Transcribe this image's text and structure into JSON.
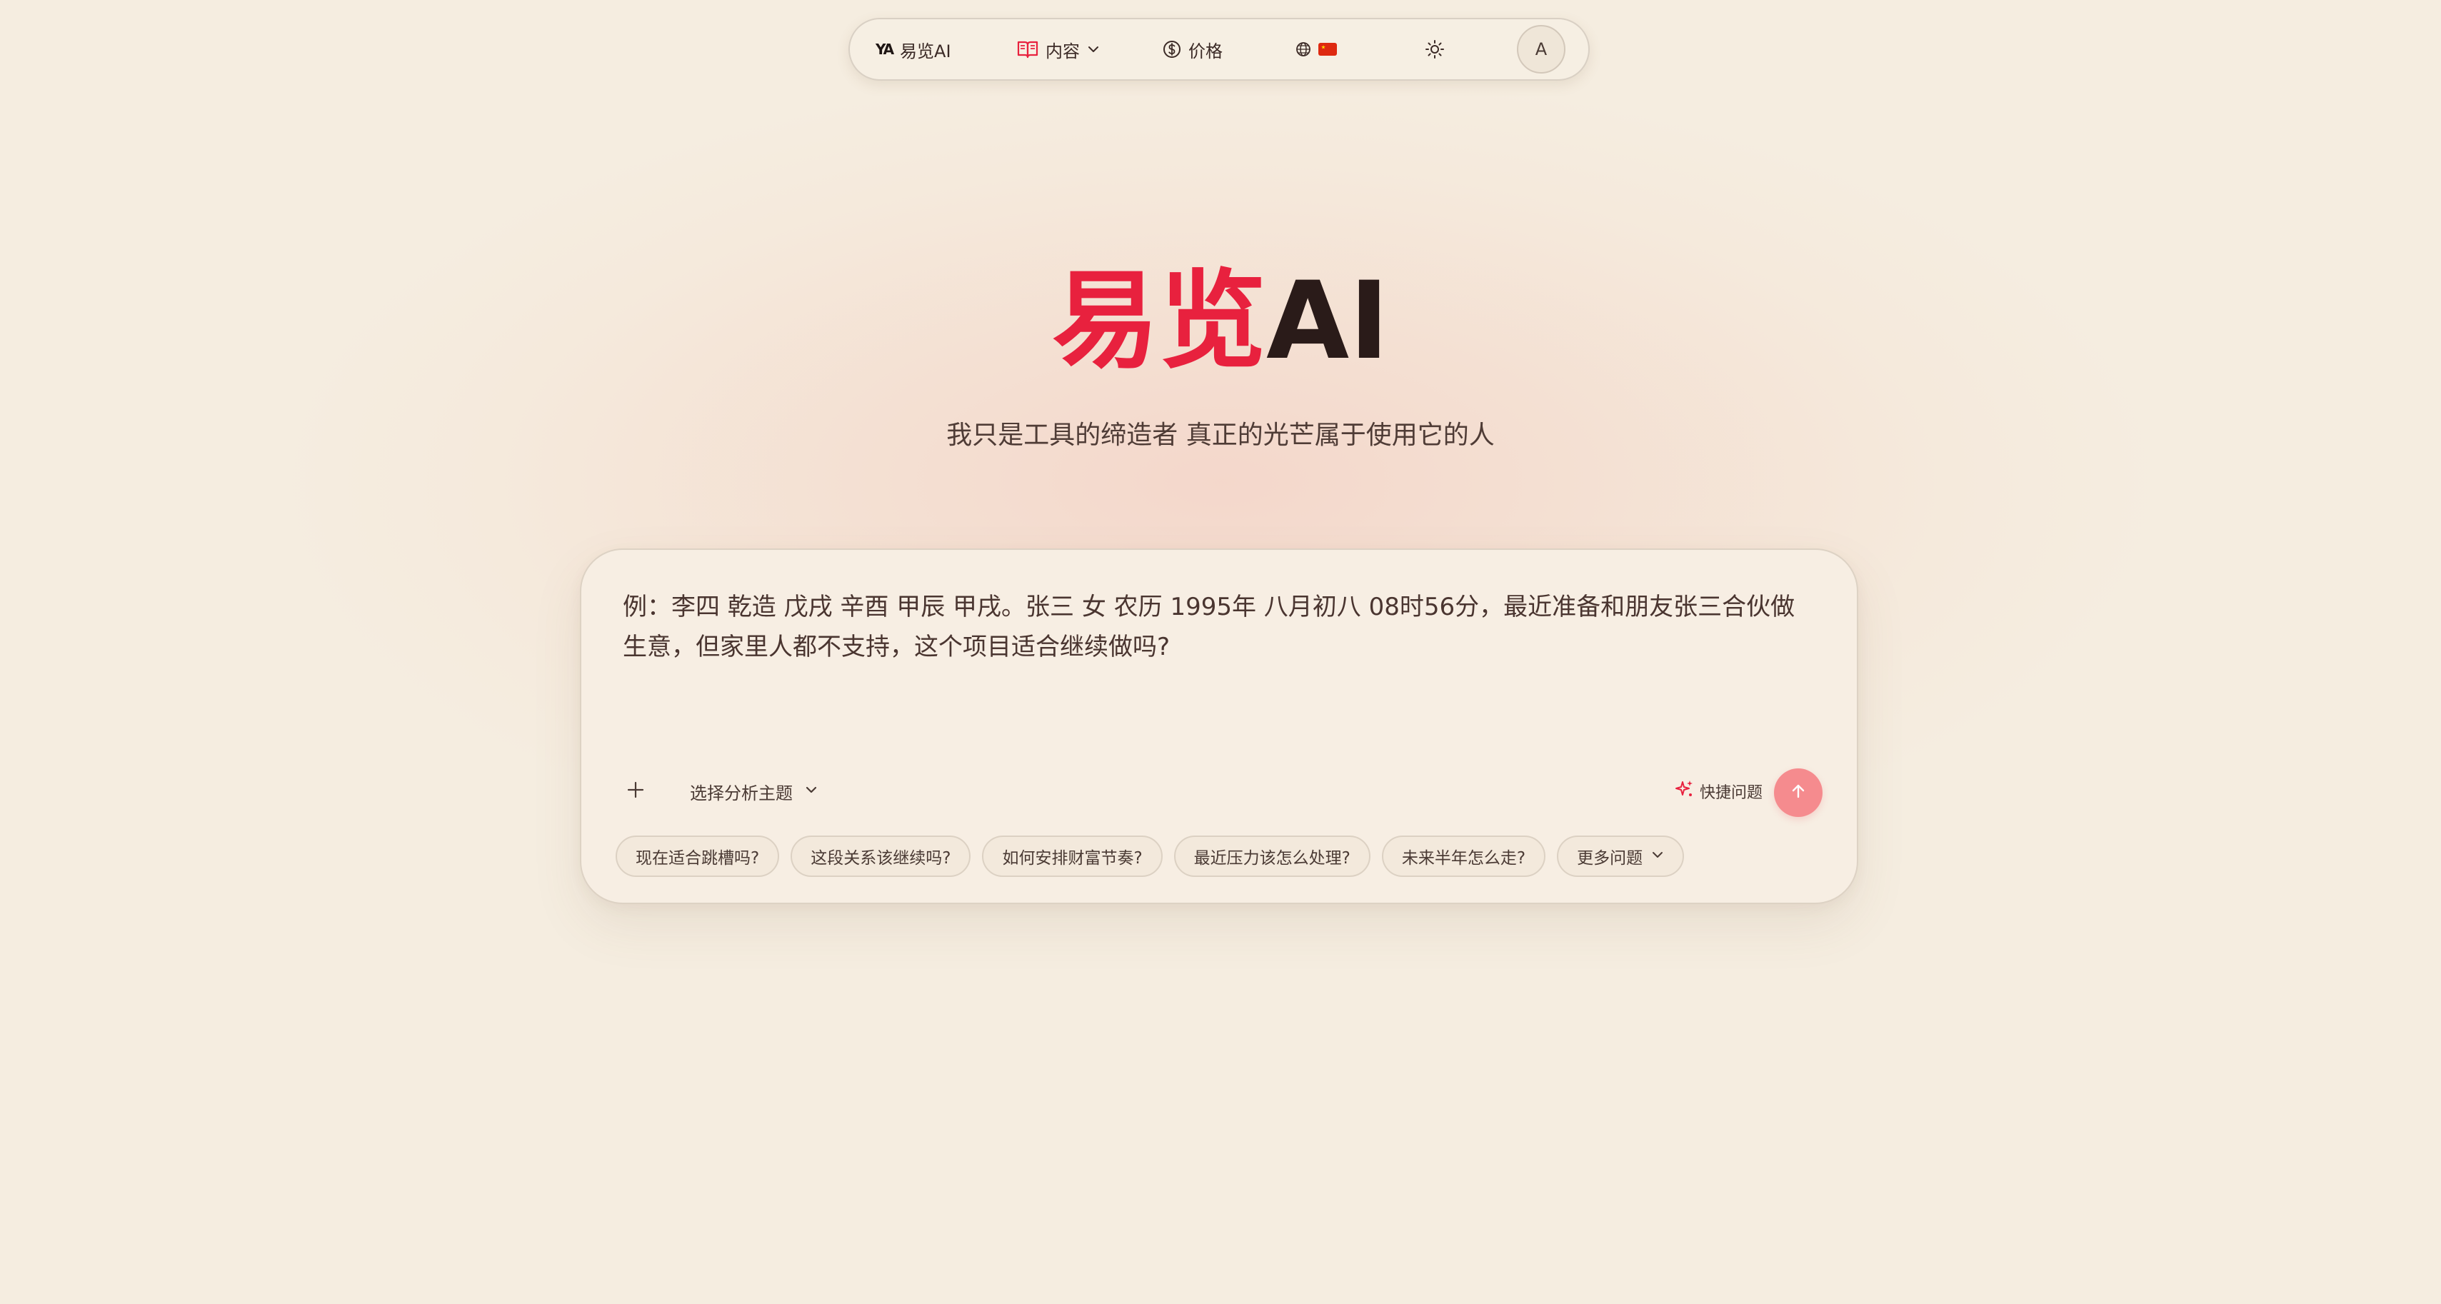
{
  "nav": {
    "logo_mark": "YA",
    "brand": "易览AI",
    "content_label": "内容",
    "pricing_label": "价格",
    "avatar_initial": "A",
    "accent_color": "#e8213e"
  },
  "hero": {
    "title_accent": "易览",
    "title_rest": "AI",
    "tagline": "我只是工具的缔造者 真正的光芒属于使用它的人"
  },
  "composer": {
    "prompt_example": "例：李四 乾造 戊戌 辛酉 甲辰 甲戌。张三 女 农历 1995年 八月初八 08时56分，最近准备和朋友张三合伙做生意，但家里人都不支持，这个项目适合继续做吗?",
    "topic_select": "选择分析主题",
    "quick_questions": "快捷问题",
    "send_color": "#f58b8e"
  },
  "chips": [
    {
      "label": "现在适合跳槽吗?"
    },
    {
      "label": "这段关系该继续吗?"
    },
    {
      "label": "如何安排财富节奏?"
    },
    {
      "label": "最近压力该怎么处理?"
    },
    {
      "label": "未来半年怎么走?"
    },
    {
      "label": "更多问题"
    }
  ]
}
